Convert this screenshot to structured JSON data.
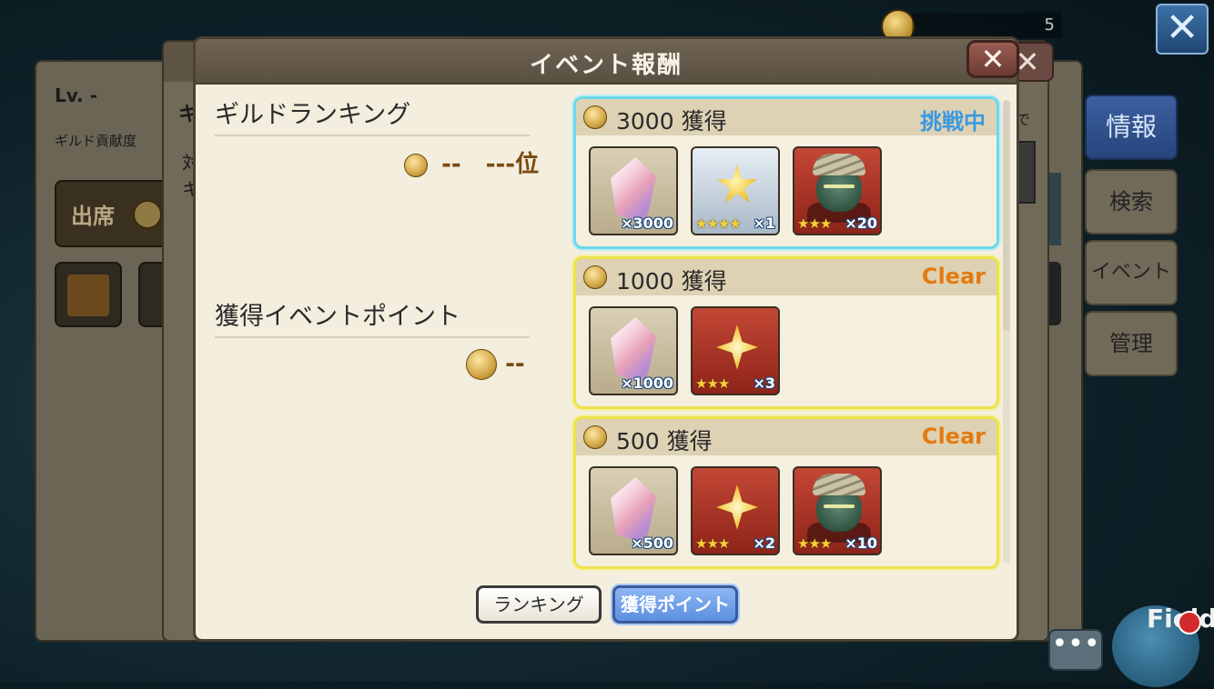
{
  "topbar": {
    "counter": "5",
    "close_label": "✕"
  },
  "background": {
    "level": "Lv. -",
    "contribution_label": "ギルド貢献度",
    "partial_ki": "キ",
    "partial_tai": "対",
    "partial_ki2": "キ",
    "partial_de": "で",
    "attend_label": "出席",
    "close_label": "✕"
  },
  "side_tabs": [
    {
      "label": "情報",
      "active": true
    },
    {
      "label": "検索",
      "active": false
    },
    {
      "label": "イベント",
      "active": false
    },
    {
      "label": "管理",
      "active": false
    }
  ],
  "field": {
    "label": "Field",
    "chat_label": "•••"
  },
  "dialog": {
    "title": "イベント報酬",
    "close_label": "✕",
    "guild_ranking": {
      "title": "ギルドランキング",
      "points": "--",
      "rank": "---位"
    },
    "event_points": {
      "title": "獲得イベントポイント",
      "value": "--"
    },
    "rewards": [
      {
        "amount": "3000",
        "acquire_label": "獲得",
        "status": "挑戦中",
        "status_color": "#3a98e0",
        "items": [
          {
            "icon": "crystal-icon",
            "qty": "×3000",
            "stars": ""
          },
          {
            "icon": "star-icon",
            "qty": "×1",
            "stars": "★★★★"
          },
          {
            "icon": "orc-warrior-icon",
            "qty": "×20",
            "stars": "★★★"
          }
        ]
      },
      {
        "amount": "1000",
        "acquire_label": "獲得",
        "status": "Clear",
        "status_color": "#e47a12",
        "items": [
          {
            "icon": "crystal-icon",
            "qty": "×1000",
            "stars": ""
          },
          {
            "icon": "spark-icon",
            "qty": "×3",
            "stars": "★★★"
          }
        ]
      },
      {
        "amount": "500",
        "acquire_label": "獲得",
        "status": "Clear",
        "status_color": "#e47a12",
        "items": [
          {
            "icon": "crystal-icon",
            "qty": "×500",
            "stars": ""
          },
          {
            "icon": "spark-icon",
            "qty": "×2",
            "stars": "★★★"
          },
          {
            "icon": "orc-warrior-icon",
            "qty": "×10",
            "stars": "★★★"
          }
        ]
      }
    ],
    "buttons": {
      "ranking": "ランキング",
      "points": "獲得ポイント"
    }
  }
}
